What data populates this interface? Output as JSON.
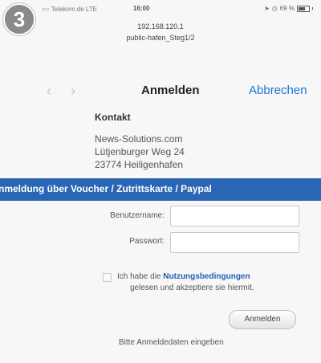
{
  "step_number": "3",
  "status_bar": {
    "carrier": "○○ Telekom.de  LTE",
    "time": "16:00",
    "battery": "69 %"
  },
  "browser": {
    "url_line1": "192.168.120.1",
    "url_line2": "public-hafen_Steg1/2"
  },
  "nav": {
    "back": "‹",
    "forward": "›",
    "title": "Anmelden",
    "cancel": "Abbrechen"
  },
  "contact": {
    "heading": "Kontakt",
    "lines": [
      "News-Solutions.com",
      "Lütjenburger Weg 24",
      "23774 Heiligenhafen"
    ]
  },
  "banner": "nmeldung über Voucher / Zutrittskarte / Paypal",
  "form": {
    "username_label": "Benutzername:",
    "password_label": "Passwort:",
    "username_value": "",
    "password_value": "",
    "terms_prefix": "Ich habe die",
    "terms_link": "Nutzungsbedingungen",
    "terms_line2": "gelesen und akzeptiere sie hiermit.",
    "login_button": "Anmelden",
    "hint": "Bitte Anmeldedaten eingeben"
  },
  "colors": {
    "accent": "#1e74d6",
    "banner": "#2a66b4"
  }
}
